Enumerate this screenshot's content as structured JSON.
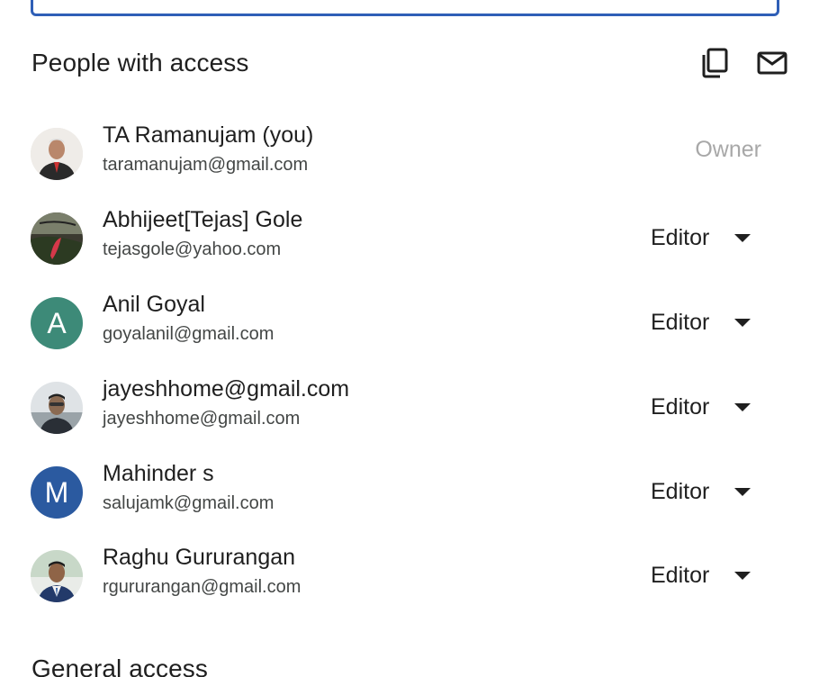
{
  "people_section": {
    "title": "People with access",
    "copy_icon": "copy-icon",
    "email_icon": "mail-icon"
  },
  "people": [
    {
      "name": "TA Ramanujam (you)",
      "email": "taramanujam@gmail.com",
      "role": "Owner",
      "avatar_type": "photo"
    },
    {
      "name": "Abhijeet[Tejas] Gole",
      "email": "tejasgole@yahoo.com",
      "role": "Editor",
      "avatar_type": "photo"
    },
    {
      "name": "Anil Goyal",
      "email": "goyalanil@gmail.com",
      "role": "Editor",
      "avatar_type": "letter",
      "avatar_letter": "A",
      "avatar_color": "#3d8a78"
    },
    {
      "name": "jayeshhome@gmail.com",
      "email": "jayeshhome@gmail.com",
      "role": "Editor",
      "avatar_type": "photo"
    },
    {
      "name": "Mahinder s",
      "email": "salujamk@gmail.com",
      "role": "Editor",
      "avatar_type": "letter",
      "avatar_letter": "M",
      "avatar_color": "#2b5aa0"
    },
    {
      "name": "Raghu Gururangan",
      "email": "rgururangan@gmail.com",
      "role": "Editor",
      "avatar_type": "photo"
    }
  ],
  "general_section": {
    "title": "General access"
  }
}
